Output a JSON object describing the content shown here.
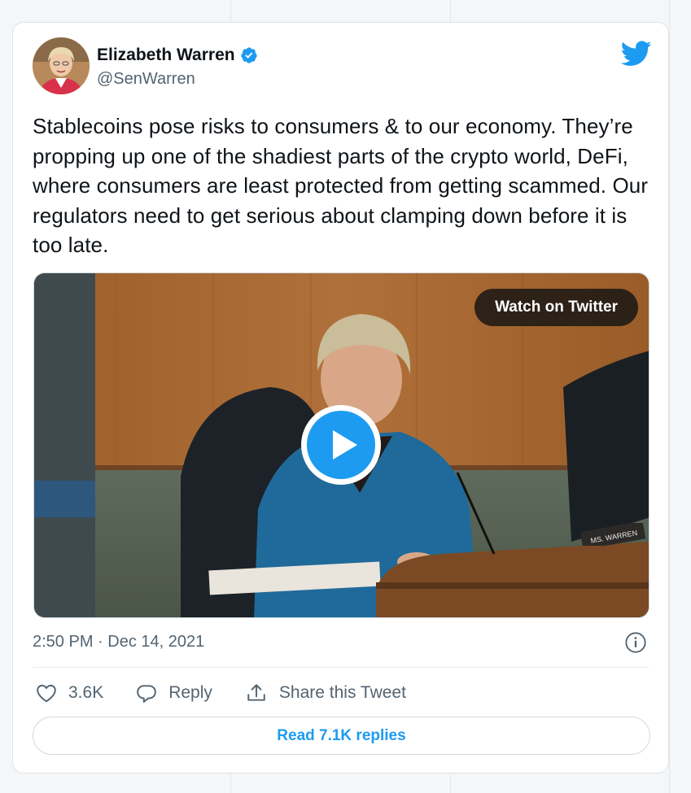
{
  "author": {
    "name": "Elizabeth Warren",
    "handle": "@SenWarren",
    "verified": true
  },
  "tweet": {
    "text": "Stablecoins pose risks to consumers & to our economy. They’re propping up one of the shadiest parts of the crypto world, DeFi, where consumers are least protected from getting scammed. Our regulators need to get serious about clamping down before it is too late.",
    "timestamp": "2:50 PM · Dec 14, 2021"
  },
  "media": {
    "watch_label": "Watch on Twitter",
    "nameplate_text": "MS. WARREN"
  },
  "actions": {
    "like_count": "3.6K",
    "reply_label": "Reply",
    "share_label": "Share this Tweet"
  },
  "read_replies_label": "Read 7.1K replies",
  "icons": {
    "like": "heart-icon",
    "reply": "speech-bubble-icon",
    "share": "share-arrow-icon",
    "info": "info-icon",
    "logo": "twitter-bird-icon",
    "play": "play-icon",
    "verified": "verified-badge-icon"
  },
  "colors": {
    "accent": "#1d9bf0",
    "text": "#0f1419",
    "muted": "#536471"
  }
}
